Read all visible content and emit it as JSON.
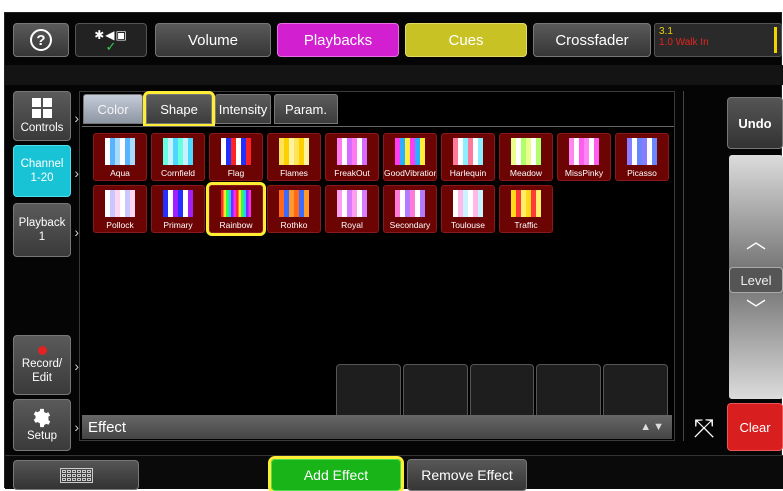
{
  "topbar": {
    "volume": "Volume",
    "playbacks": "Playbacks",
    "cues": "Cues",
    "crossfader": "Crossfader",
    "cue_number": "3.1",
    "cue_name": "1.0 Walk In"
  },
  "sidebar": {
    "controls": "Controls",
    "channel_1": "Channel",
    "channel_2": "1-20",
    "playback_1": "Playback",
    "playback_2": "1",
    "record_1": "Record/",
    "record_2": "Edit",
    "setup": "Setup"
  },
  "tabs": {
    "color": "Color",
    "shape": "Shape",
    "intensity": "Intensity",
    "param": "Param."
  },
  "effects": [
    {
      "label": "Aqua",
      "colors": [
        "#ffffff",
        "#5ab3ff",
        "#a8dcff"
      ]
    },
    {
      "label": "Cornfield",
      "colors": [
        "#66ffe0",
        "#c8f0ff",
        "#4fd8ff"
      ]
    },
    {
      "label": "Flag",
      "colors": [
        "#ffffff",
        "#2230ff",
        "#ff2222"
      ]
    },
    {
      "label": "Flames",
      "colors": [
        "#ffe45a",
        "#ffd000",
        "#fff2a0"
      ]
    },
    {
      "label": "FreakOut",
      "colors": [
        "#ff7af0",
        "#ffffff",
        "#d66cff"
      ]
    },
    {
      "label": "GoodVibration",
      "colors": [
        "#ff3cf0",
        "#2ab0ff",
        "#ffee3a"
      ]
    },
    {
      "label": "Harlequin",
      "colors": [
        "#ff7a9a",
        "#ffffff",
        "#8af0ff"
      ]
    },
    {
      "label": "Meadow",
      "colors": [
        "#eaff8a",
        "#ffffff",
        "#b0ff6a"
      ]
    },
    {
      "label": "MissPinky",
      "colors": [
        "#ff86f2",
        "#ffffff",
        "#ff5cf0"
      ]
    },
    {
      "label": "Picasso",
      "colors": [
        "#8a7cff",
        "#ffffff",
        "#6a86ff"
      ]
    },
    {
      "label": "Pollock",
      "colors": [
        "#ffffff",
        "#c8c8ff",
        "#ffd6f0"
      ]
    },
    {
      "label": "Primary",
      "colors": [
        "#2430ff",
        "#ffffff",
        "#a020ff"
      ]
    },
    {
      "label": "Rainbow",
      "colors": [
        "#ff2a2a",
        "#ffe42a",
        "#2aff4a",
        "#2ac8ff",
        "#7a2aff",
        "#ff2af0"
      ]
    },
    {
      "label": "Rothko",
      "colors": [
        "#ff6a1a",
        "#3a6aff",
        "#ff9a2a"
      ]
    },
    {
      "label": "Royal",
      "colors": [
        "#ff9ef0",
        "#ffffff",
        "#d77cff"
      ]
    },
    {
      "label": "Secondary",
      "colors": [
        "#ff7ad8",
        "#ffffff",
        "#b37aff"
      ]
    },
    {
      "label": "Toulouse",
      "colors": [
        "#ffffff",
        "#ffb8e8",
        "#c8f4ff"
      ]
    },
    {
      "label": "Traffic",
      "colors": [
        "#ffd91a",
        "#ff3a3a",
        "#ffee6a"
      ]
    }
  ],
  "bottom": {
    "effect_label": "Effect",
    "add_effect": "Add Effect",
    "remove_effect": "Remove Effect"
  },
  "right": {
    "undo": "Undo",
    "level": "Level",
    "clear": "Clear"
  },
  "colors": {
    "playbacks": "#d21fd0",
    "cues": "#c8c224",
    "channel": "#19c3d6",
    "add_effect": "#18b418",
    "clear": "#d81e1e",
    "effect_tile": "#6c0404",
    "highlight": "#ffee33"
  }
}
